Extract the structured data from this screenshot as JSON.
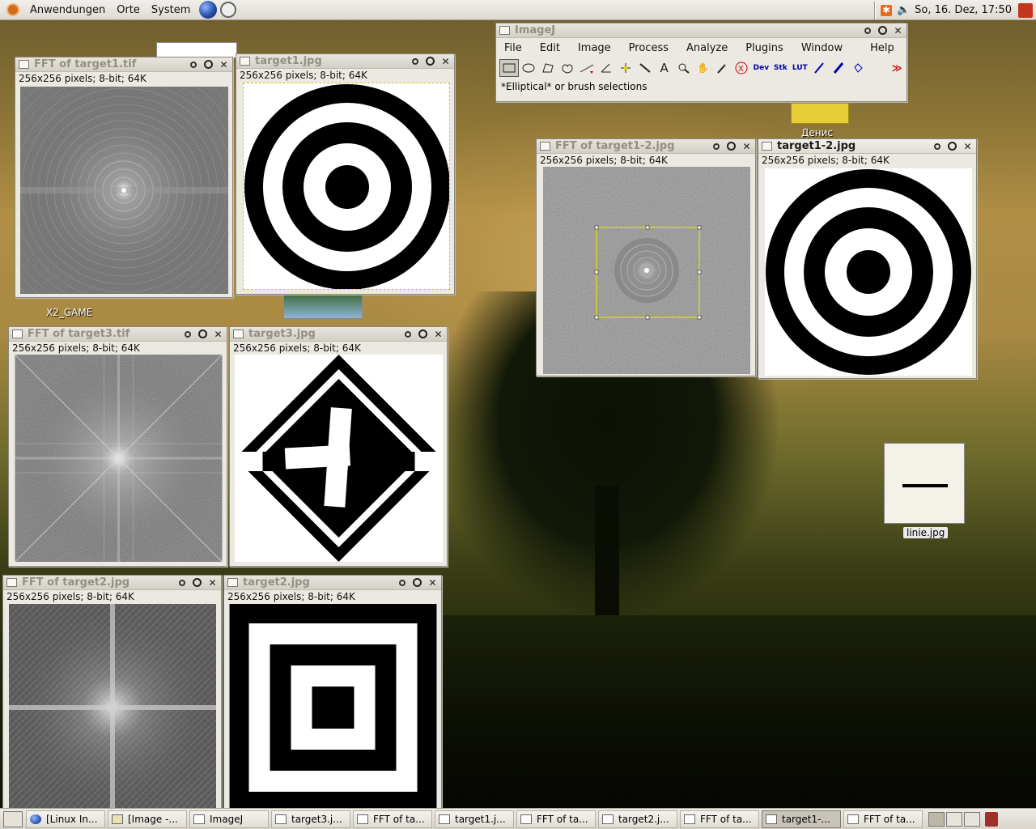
{
  "top_panel": {
    "menus": [
      "Anwendungen",
      "Orte",
      "System"
    ],
    "clock": "So, 16. Dez, 17:50"
  },
  "desktop": {
    "icons": [
      {
        "label": "X2_GAME"
      },
      {
        "label": "Денис"
      },
      {
        "label": "linie.jpg"
      }
    ]
  },
  "imagej": {
    "title": "ImageJ",
    "menu": [
      "File",
      "Edit",
      "Image",
      "Process",
      "Analyze",
      "Plugins",
      "Window",
      "Help"
    ],
    "tools": [
      "Rectangle",
      "Oval",
      "Polygon",
      "Freehand",
      "Line",
      "Angle",
      "Point",
      "Wand",
      "Text",
      "Magnifier",
      "Hand",
      "Dropper",
      "X",
      "Dev",
      "Stk",
      "LUT",
      "Pencil",
      "Brush",
      "Flood",
      "",
      ">>"
    ],
    "status": "*Elliptical* or brush selections"
  },
  "windows": [
    {
      "id": "fft1",
      "title": "FFT of target1.tif",
      "info": "256x256 pixels; 8-bit; 64K"
    },
    {
      "id": "t1",
      "title": "target1.jpg",
      "info": "256x256 pixels; 8-bit; 64K"
    },
    {
      "id": "fft12",
      "title": "FFT of target1-2.jpg",
      "info": "256x256 pixels; 8-bit; 64K"
    },
    {
      "id": "t12",
      "title": "target1-2.jpg",
      "info": "256x256 pixels; 8-bit; 64K"
    },
    {
      "id": "fft3",
      "title": "FFT of target3.tif",
      "info": "256x256 pixels; 8-bit; 64K"
    },
    {
      "id": "t3",
      "title": "target3.jpg",
      "info": "256x256 pixels; 8-bit; 64K"
    },
    {
      "id": "fft2",
      "title": "FFT of target2.jpg",
      "info": "256x256 pixels; 8-bit; 64K"
    },
    {
      "id": "t2",
      "title": "target2.jpg",
      "info": "256x256 pixels; 8-bit; 64K"
    }
  ],
  "taskbar": {
    "tasks": [
      "[Linux In...",
      "[Image -...",
      "ImageJ",
      "target3.j...",
      "FFT of ta...",
      "target1.j...",
      "FFT of ta...",
      "target2.j...",
      "FFT of ta...",
      "target1-...",
      "FFT of ta..."
    ],
    "active_index": 9
  }
}
